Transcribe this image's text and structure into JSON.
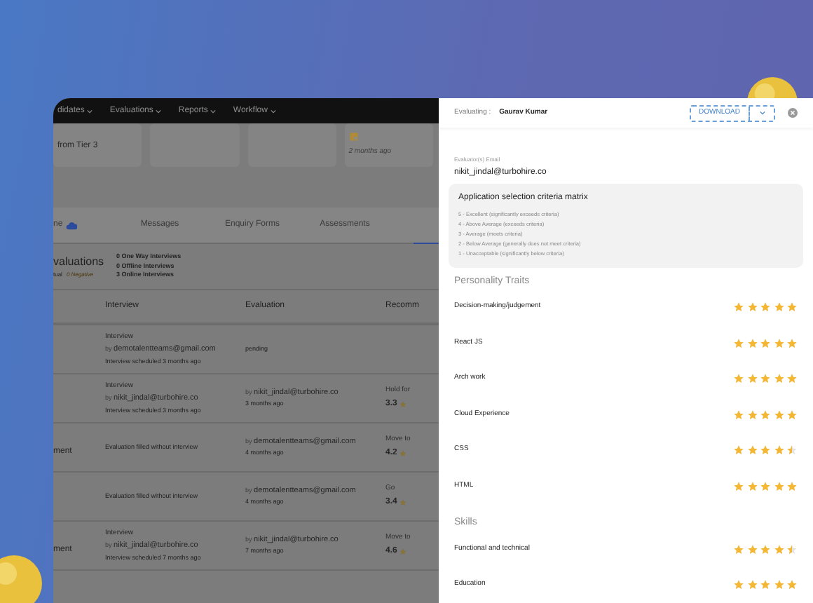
{
  "nav": {
    "menus": [
      {
        "label": "didates"
      },
      {
        "label": "Evaluations"
      },
      {
        "label": "Reports"
      },
      {
        "label": "Workflow"
      }
    ]
  },
  "summary_cards": [
    {
      "kind": "text",
      "text": "from Tier 3"
    },
    {
      "kind": "blank"
    },
    {
      "kind": "blank"
    },
    {
      "kind": "icon",
      "time": "2 months ago"
    }
  ],
  "tabs": [
    {
      "label": "ne",
      "kind": "cloud"
    },
    {
      "label": "Messages",
      "kind": "plain"
    },
    {
      "label": "Enquiry Forms",
      "kind": "plain"
    },
    {
      "label": "Assessments",
      "kind": "plain"
    }
  ],
  "stats": {
    "title": "valuations",
    "subtitle": "tual",
    "negative": "0 Negative",
    "lines": [
      "0 One Way Interviews",
      "0 Offline Interviews",
      "3 Online Interviews"
    ]
  },
  "table": {
    "columns": [
      "Interview",
      "Evaluation",
      "Recomm"
    ],
    "rows": [
      {
        "lead": "",
        "interview": {
          "kind": "interview",
          "title": "Interview",
          "by": "by",
          "email": "demotalentteams@gmail.com",
          "note": "Interview scheduled 3 months ago"
        },
        "evaluation": {
          "kind": "pending",
          "text": "pending"
        }
      },
      {
        "lead": "",
        "interview": {
          "kind": "interview",
          "title": "Interview",
          "by": "by",
          "email": "nikit_jindal@turbohire.co",
          "note": "Interview scheduled 3 months ago"
        },
        "evaluation": {
          "kind": "done",
          "by": "by",
          "email": "nikit_jindal@turbohire.co",
          "time": "3 months ago"
        },
        "recommendation": {
          "label": "Hold for",
          "score": "3.3"
        }
      },
      {
        "lead": "ment",
        "interview": {
          "kind": "none",
          "note": "Evaluation filled without interview"
        },
        "evaluation": {
          "kind": "done",
          "by": "by",
          "email": "demotalentteams@gmail.com",
          "time": "4 months ago"
        },
        "recommendation": {
          "label": "Move to",
          "score": "4.2"
        }
      },
      {
        "lead": "",
        "interview": {
          "kind": "none",
          "note": "Evaluation filled without interview"
        },
        "evaluation": {
          "kind": "done",
          "by": "by",
          "email": "demotalentteams@gmail.com",
          "time": "4 months ago"
        },
        "recommendation": {
          "label": "Go",
          "score": "3.4"
        }
      },
      {
        "lead": "ment",
        "interview": {
          "kind": "interview",
          "title": "Interview",
          "by": "by",
          "email": "nikit_jindal@turbohire.co",
          "note": "Interview scheduled 7 months ago"
        },
        "evaluation": {
          "kind": "done",
          "by": "by",
          "email": "nikit_jindal@turbohire.co",
          "time": "7 months ago"
        },
        "recommendation": {
          "label": "Move to",
          "score": "4.6"
        }
      }
    ]
  },
  "panel": {
    "label": "Evaluating :",
    "candidate": "Gaurav Kumar",
    "download": "DOWNLOAD",
    "email_label": "Evaluator(s) Email",
    "email": "nikit_jindal@turbohire.co",
    "matrix": {
      "title": "Application selection criteria matrix",
      "lines": [
        "5 - Excellent (significantly exceeds criteria)",
        "4 - Above Average (exceeds criteria)",
        "3 - Average (meets criteria)",
        "2 - Below Average (generally does not meet criteria)",
        "1 - Unacceptable (significantly below criteria)"
      ]
    },
    "sections": [
      {
        "title": "Personality Traits",
        "items": [
          {
            "name": "Decision-making/judgement",
            "stars": 5
          },
          {
            "name": "React JS",
            "stars": 5
          },
          {
            "name": "Arch work",
            "stars": 5
          },
          {
            "name": "Cloud Experience",
            "stars": 5
          },
          {
            "name": "CSS",
            "stars": 4.5
          },
          {
            "name": "HTML",
            "stars": 5
          }
        ]
      },
      {
        "title": "Skills",
        "items": [
          {
            "name": "Functional and technical",
            "stars": 4.5
          },
          {
            "name": "Education",
            "stars": 5
          }
        ]
      }
    ]
  }
}
